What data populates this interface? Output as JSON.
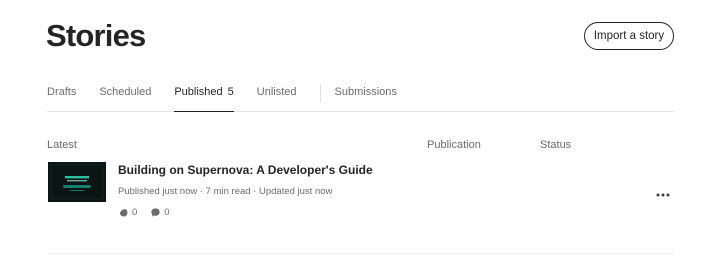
{
  "page": {
    "title": "Stories"
  },
  "header": {
    "import_label": "Import a story"
  },
  "tabs": [
    {
      "label": "Drafts"
    },
    {
      "label": "Scheduled"
    },
    {
      "label": "Published",
      "count": "5",
      "active": true
    },
    {
      "label": "Unlisted"
    },
    {
      "label": "Submissions"
    }
  ],
  "columns": {
    "latest": "Latest",
    "publication": "Publication",
    "status": "Status"
  },
  "story": {
    "title": "Building on Supernova: A Developer's Guide",
    "meta": "Published just now · 7 min read · Updated just now",
    "claps": "0",
    "responses": "0",
    "thumbnail_icon": "supernova-banner-image",
    "more_icon": "more-horizontal-icon"
  },
  "colors": {
    "text": "#242424",
    "muted": "#6b6b6b",
    "thumb_bg": "#0b1614",
    "thumb_accent": "#2fd1b5"
  }
}
